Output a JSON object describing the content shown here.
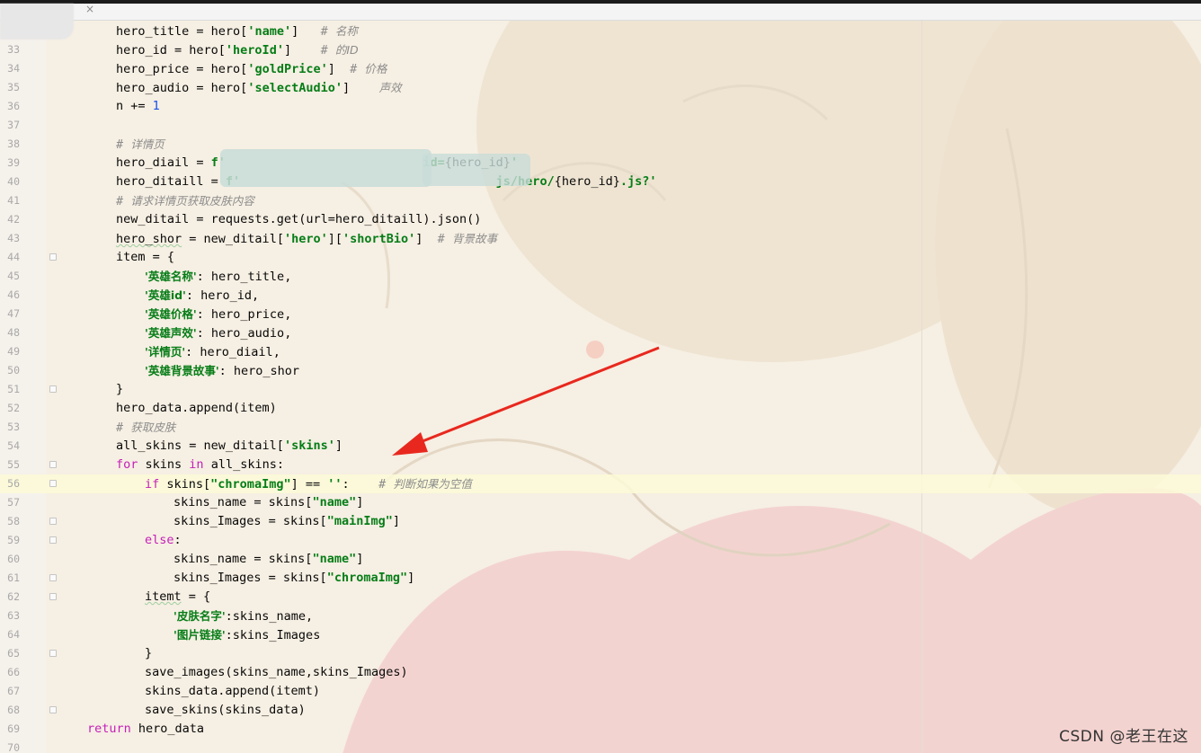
{
  "tab": {
    "close_glyph": "×"
  },
  "editor": {
    "lines": [
      {
        "num": "",
        "indent": 2,
        "tokens": [
          {
            "t": "hero_title = hero["
          },
          {
            "t": "'name'",
            "c": "str"
          },
          {
            "t": "]   "
          },
          {
            "t": "# ",
            "c": "cmt"
          },
          {
            "t": "名称",
            "c": "cmt-cn"
          }
        ]
      },
      {
        "num": "33",
        "indent": 2,
        "tokens": [
          {
            "t": "hero_id = hero["
          },
          {
            "t": "'heroId'",
            "c": "str"
          },
          {
            "t": "]    "
          },
          {
            "t": "# ",
            "c": "cmt"
          },
          {
            "t": "的ID",
            "c": "cmt-cn"
          }
        ]
      },
      {
        "num": "34",
        "indent": 2,
        "tokens": [
          {
            "t": "hero_price = hero["
          },
          {
            "t": "'goldPrice'",
            "c": "str"
          },
          {
            "t": "]  "
          },
          {
            "t": "# ",
            "c": "cmt"
          },
          {
            "t": "价格",
            "c": "cmt-cn"
          }
        ]
      },
      {
        "num": "35",
        "indent": 2,
        "tokens": [
          {
            "t": "hero_audio = hero["
          },
          {
            "t": "'selectAudio'",
            "c": "str"
          },
          {
            "t": "]    "
          },
          {
            "t": "声效",
            "c": "cmt-cn"
          }
        ]
      },
      {
        "num": "36",
        "indent": 2,
        "tokens": [
          {
            "t": "n += "
          },
          {
            "t": "1",
            "c": "num"
          }
        ]
      },
      {
        "num": "37",
        "indent": 0,
        "tokens": []
      },
      {
        "num": "38",
        "indent": 2,
        "tokens": [
          {
            "t": "# ",
            "c": "cmt"
          },
          {
            "t": "详情页",
            "c": "cmt-cn"
          }
        ]
      },
      {
        "num": "39",
        "indent": 2,
        "tokens": [
          {
            "t": "hero_diail = "
          },
          {
            "t": "f'",
            "c": "str"
          },
          {
            "t": "                           "
          },
          {
            "t": "id=",
            "c": "str"
          },
          {
            "t": "{hero_id}"
          },
          {
            "t": "'",
            "c": "str"
          }
        ]
      },
      {
        "num": "40",
        "indent": 2,
        "tokens": [
          {
            "t": "hero_ditaill = "
          },
          {
            "t": "f'",
            "c": "str"
          },
          {
            "t": "                                   "
          },
          {
            "t": "js/hero/",
            "c": "str"
          },
          {
            "t": "{hero_id}"
          },
          {
            "t": ".js?'",
            "c": "str"
          }
        ]
      },
      {
        "num": "41",
        "indent": 2,
        "tokens": [
          {
            "t": "# ",
            "c": "cmt"
          },
          {
            "t": "请求详情页获取皮肤内容",
            "c": "cmt-cn"
          }
        ]
      },
      {
        "num": "42",
        "indent": 2,
        "tokens": [
          {
            "t": "new_ditail = requests.get(url=hero_ditaill).json()"
          }
        ]
      },
      {
        "num": "43",
        "indent": 2,
        "tokens": [
          {
            "t": "hero_shor",
            "c": "wavy"
          },
          {
            "t": " = new_ditail["
          },
          {
            "t": "'hero'",
            "c": "str"
          },
          {
            "t": "]["
          },
          {
            "t": "'shortBio'",
            "c": "str"
          },
          {
            "t": "]  "
          },
          {
            "t": "# ",
            "c": "cmt"
          },
          {
            "t": "背景故事",
            "c": "cmt-cn"
          }
        ]
      },
      {
        "num": "44",
        "indent": 2,
        "fold": true,
        "tokens": [
          {
            "t": "item = {"
          }
        ]
      },
      {
        "num": "45",
        "indent": 3,
        "tokens": [
          {
            "t": "'英雄名称'",
            "c": "str-cn"
          },
          {
            "t": ": hero_title,"
          }
        ]
      },
      {
        "num": "46",
        "indent": 3,
        "tokens": [
          {
            "t": "'英雄id'",
            "c": "str-cn"
          },
          {
            "t": ": hero_id,"
          }
        ]
      },
      {
        "num": "47",
        "indent": 3,
        "tokens": [
          {
            "t": "'英雄价格'",
            "c": "str-cn"
          },
          {
            "t": ": hero_price,"
          }
        ]
      },
      {
        "num": "48",
        "indent": 3,
        "tokens": [
          {
            "t": "'英雄声效'",
            "c": "str-cn"
          },
          {
            "t": ": hero_audio,"
          }
        ]
      },
      {
        "num": "49",
        "indent": 3,
        "tokens": [
          {
            "t": "'详情页'",
            "c": "str-cn"
          },
          {
            "t": ": hero_diail,"
          }
        ]
      },
      {
        "num": "50",
        "indent": 3,
        "tokens": [
          {
            "t": "'英雄背景故事'",
            "c": "str-cn"
          },
          {
            "t": ": hero_shor"
          }
        ]
      },
      {
        "num": "51",
        "indent": 2,
        "fold": true,
        "tokens": [
          {
            "t": "}"
          }
        ]
      },
      {
        "num": "52",
        "indent": 2,
        "tokens": [
          {
            "t": "hero_data.append(item)"
          }
        ]
      },
      {
        "num": "53",
        "indent": 2,
        "tokens": [
          {
            "t": "# ",
            "c": "cmt"
          },
          {
            "t": "获取皮肤",
            "c": "cmt-cn"
          }
        ]
      },
      {
        "num": "54",
        "indent": 2,
        "tokens": [
          {
            "t": "all_skins = new_ditail["
          },
          {
            "t": "'skins'",
            "c": "str"
          },
          {
            "t": "]"
          }
        ]
      },
      {
        "num": "55",
        "indent": 2,
        "fold": true,
        "tokens": [
          {
            "t": "for",
            "c": "kwp"
          },
          {
            "t": " skins "
          },
          {
            "t": "in",
            "c": "kwp"
          },
          {
            "t": " all_skins:"
          }
        ]
      },
      {
        "num": "56",
        "indent": 3,
        "fold": true,
        "current": true,
        "tokens": [
          {
            "t": "if",
            "c": "kwp"
          },
          {
            "t": " skins["
          },
          {
            "t": "\"chromaImg\"",
            "c": "str"
          },
          {
            "t": "] == "
          },
          {
            "t": "''",
            "c": "str"
          },
          {
            "t": ":    "
          },
          {
            "t": "# ",
            "c": "cmt"
          },
          {
            "t": "判断如果为空值",
            "c": "cmt-cn"
          }
        ]
      },
      {
        "num": "57",
        "indent": 4,
        "tokens": [
          {
            "t": "skins_name = skins["
          },
          {
            "t": "\"name\"",
            "c": "str"
          },
          {
            "t": "]"
          }
        ]
      },
      {
        "num": "58",
        "indent": 4,
        "fold": true,
        "tokens": [
          {
            "t": "skins_Images = skins["
          },
          {
            "t": "\"mainImg\"",
            "c": "str"
          },
          {
            "t": "]"
          }
        ]
      },
      {
        "num": "59",
        "indent": 3,
        "fold": true,
        "tokens": [
          {
            "t": "else",
            "c": "kwp"
          },
          {
            "t": ":"
          }
        ]
      },
      {
        "num": "60",
        "indent": 4,
        "tokens": [
          {
            "t": "skins_name = skins["
          },
          {
            "t": "\"name\"",
            "c": "str"
          },
          {
            "t": "]"
          }
        ]
      },
      {
        "num": "61",
        "indent": 4,
        "fold": true,
        "tokens": [
          {
            "t": "skins_Images = skins["
          },
          {
            "t": "\"chromaImg\"",
            "c": "str"
          },
          {
            "t": "]"
          }
        ]
      },
      {
        "num": "62",
        "indent": 3,
        "fold": true,
        "tokens": [
          {
            "t": "itemt",
            "c": "wavy"
          },
          {
            "t": " = {"
          }
        ]
      },
      {
        "num": "63",
        "indent": 4,
        "tokens": [
          {
            "t": "'皮肤名字'",
            "c": "str-cn"
          },
          {
            "t": ":skins_name,"
          }
        ]
      },
      {
        "num": "64",
        "indent": 4,
        "tokens": [
          {
            "t": "'图片链接'",
            "c": "str-cn"
          },
          {
            "t": ":skins_Images"
          }
        ]
      },
      {
        "num": "65",
        "indent": 3,
        "fold": true,
        "tokens": [
          {
            "t": "}"
          }
        ]
      },
      {
        "num": "66",
        "indent": 3,
        "tokens": [
          {
            "t": "save_images(skins_name,skins_Images)"
          }
        ]
      },
      {
        "num": "67",
        "indent": 3,
        "tokens": [
          {
            "t": "skins_data.append(itemt)"
          }
        ]
      },
      {
        "num": "68",
        "indent": 3,
        "fold": true,
        "tokens": [
          {
            "t": "save_skins(skins_data)"
          }
        ]
      },
      {
        "num": "69",
        "indent": 1,
        "tokens": [
          {
            "t": "return",
            "c": "kwp"
          },
          {
            "t": " hero_data"
          }
        ]
      },
      {
        "num": "70",
        "indent": 0,
        "tokens": []
      }
    ]
  },
  "watermark": "CSDN @老王在这",
  "colors": {
    "keyword": "#c41fb8",
    "string": "#067d17",
    "number": "#1750eb",
    "comment": "#8c8c8c",
    "arrow": "#e8281e",
    "current_line": "#fcfad7"
  }
}
